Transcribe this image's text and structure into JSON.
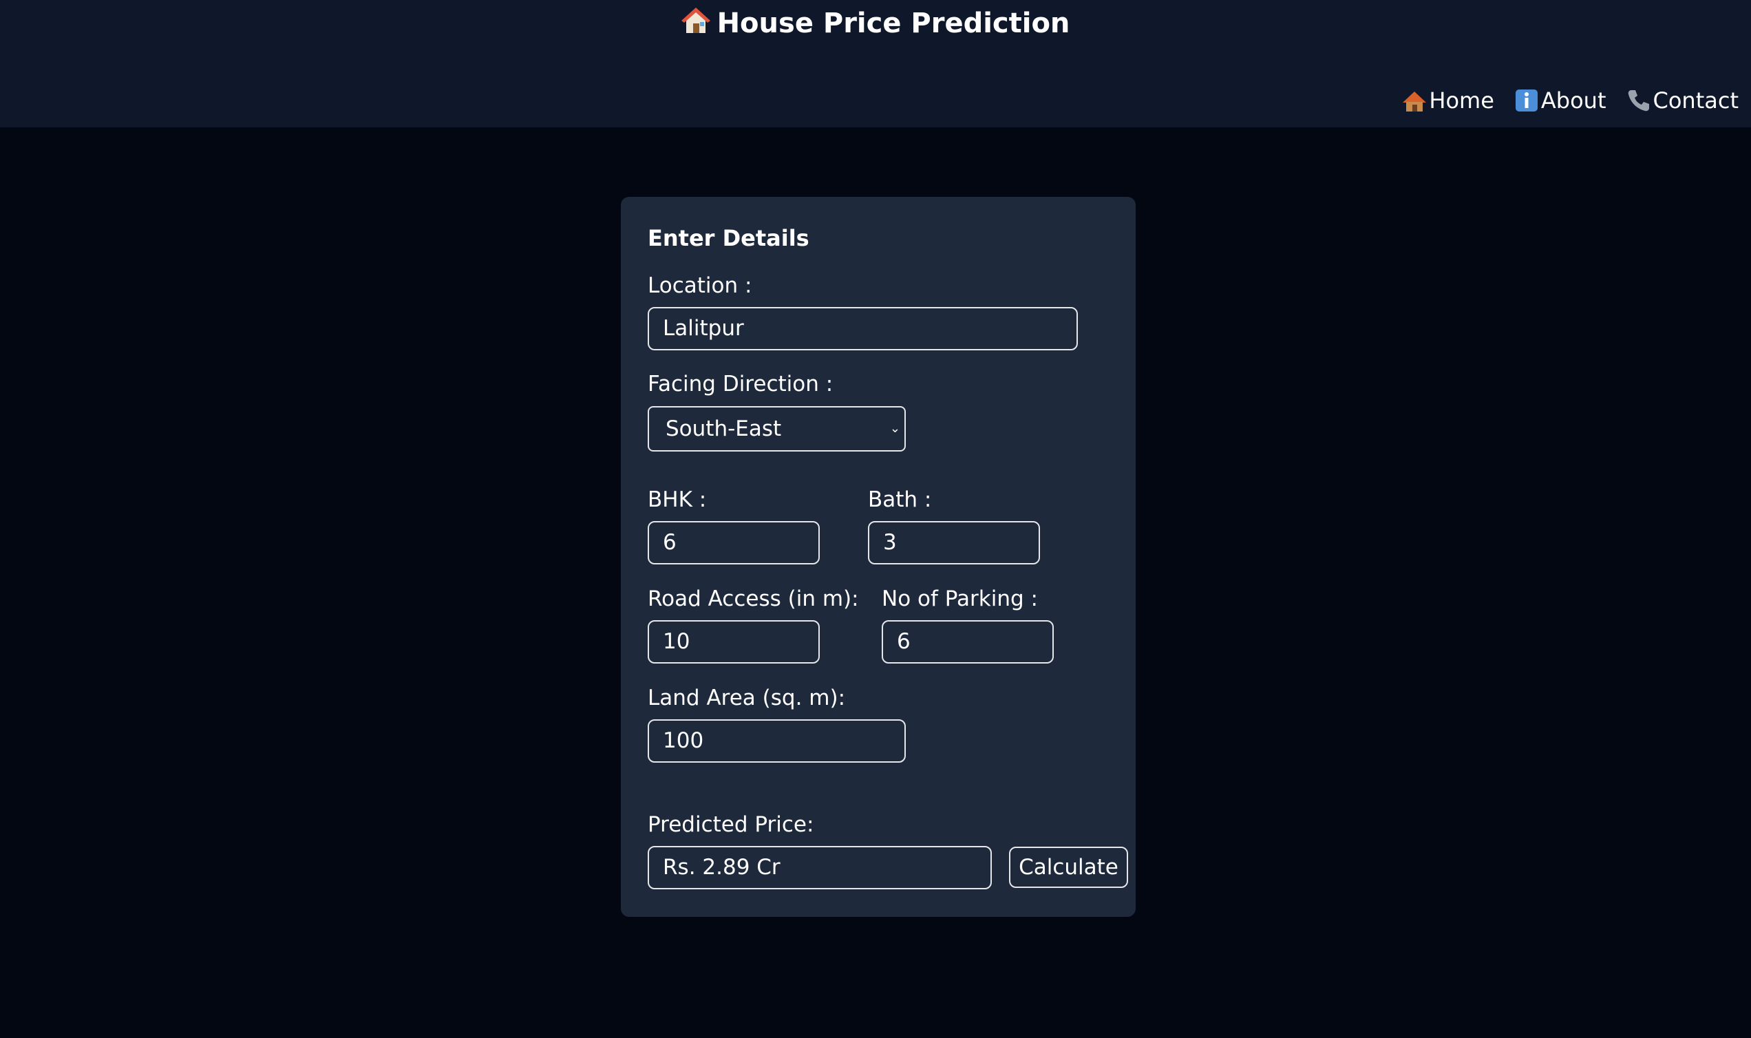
{
  "header": {
    "title": "House Price Prediction",
    "title_icon": "house-icon",
    "nav": [
      {
        "label": "Home",
        "icon": "hut-icon"
      },
      {
        "label": "About",
        "icon": "info-icon"
      },
      {
        "label": "Contact",
        "icon": "phone-icon"
      }
    ]
  },
  "form": {
    "title": "Enter Details",
    "location": {
      "label": "Location :",
      "value": "Lalitpur"
    },
    "facing": {
      "label": "Facing Direction :",
      "value": "South-East"
    },
    "bhk": {
      "label": "BHK :",
      "value": "6"
    },
    "bath": {
      "label": "Bath :",
      "value": "3"
    },
    "road": {
      "label": "Road Access (in m):",
      "value": "10"
    },
    "parking": {
      "label": "No of Parking :",
      "value": "6"
    },
    "land": {
      "label": "Land Area (sq. m):",
      "value": "100"
    },
    "predicted": {
      "label": "Predicted Price:",
      "value": "Rs. 2.89  Cr"
    },
    "calculate_label": "Calculate"
  },
  "colors": {
    "background": "#030712",
    "header": "#0f172a",
    "card": "#1e293b",
    "border": "#e5e7eb"
  }
}
